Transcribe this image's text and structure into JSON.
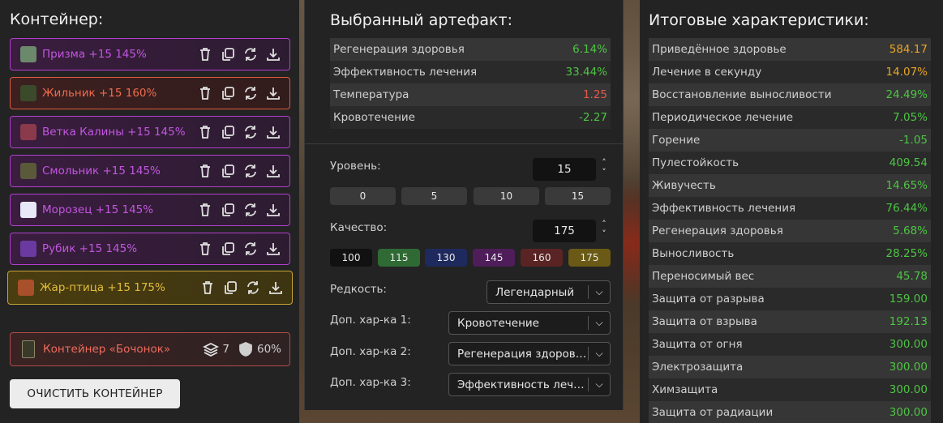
{
  "left": {
    "title": "Контейнер:",
    "items": [
      {
        "name": "Призма +15 145%",
        "variant": "purple",
        "thumb": "#6b8a6b"
      },
      {
        "name": "Жильник +15 160%",
        "variant": "red",
        "thumb": "#3a4a2a"
      },
      {
        "name": "Ветка Калины +15 145%",
        "variant": "purple",
        "thumb": "#8a3a4a"
      },
      {
        "name": "Смольник +15 145%",
        "variant": "purple",
        "thumb": "#5a5a3a"
      },
      {
        "name": "Морозец +15 145%",
        "variant": "purple",
        "thumb": "#e8e8f8"
      },
      {
        "name": "Рубик +15 145%",
        "variant": "purple",
        "thumb": "#6a3aa0"
      },
      {
        "name": "Жар-птица +15 175%",
        "variant": "gold",
        "thumb": "#a8502a"
      }
    ],
    "container": {
      "name": "Контейнер «Бочонок»",
      "slots": "7",
      "protection": "60%"
    },
    "clear_label": "ОЧИСТИТЬ КОНТЕЙНЕР"
  },
  "mid": {
    "title": "Выбранный артефакт:",
    "stats": [
      {
        "label": "Регенерация здоровья",
        "value": "6.14%",
        "tone": "g"
      },
      {
        "label": "Эффективность лечения",
        "value": "33.44%",
        "tone": "g"
      },
      {
        "label": "Температура",
        "value": "1.25",
        "tone": "r"
      },
      {
        "label": "Кровотечение",
        "value": "-2.27",
        "tone": "g"
      }
    ],
    "level_label": "Уровень:",
    "level_value": "15",
    "level_presets": [
      "0",
      "5",
      "10",
      "15"
    ],
    "quality_label": "Качество:",
    "quality_value": "175",
    "quality_presets": [
      {
        "label": "100",
        "color": "#111111"
      },
      {
        "label": "115",
        "color": "#2f6a34"
      },
      {
        "label": "130",
        "color": "#1e2a5e"
      },
      {
        "label": "145",
        "color": "#4e1d5a"
      },
      {
        "label": "160",
        "color": "#5a2424"
      },
      {
        "label": "175",
        "color": "#6a5a16"
      }
    ],
    "rarity_label": "Редкость:",
    "rarity_value": "Легендарный",
    "extra1_label": "Доп. хар-ка 1:",
    "extra1_value": "Кровотечение",
    "extra2_label": "Доп. хар-ка 2:",
    "extra2_value": "Регенерация здоровья",
    "extra3_label": "Доп. хар-ка 3:",
    "extra3_value": "Эффективность лечения"
  },
  "right": {
    "title": "Итоговые характеристики:",
    "stats": [
      {
        "label": "Приведённое здоровье",
        "value": "584.17",
        "tone": "o"
      },
      {
        "label": "Лечение в секунду",
        "value": "14.07%",
        "tone": "o"
      },
      {
        "label": "Восстановление выносливости",
        "value": "24.49%",
        "tone": "g"
      },
      {
        "label": "Периодическое лечение",
        "value": "7.05%",
        "tone": "g"
      },
      {
        "label": "Горение",
        "value": "-1.05",
        "tone": "g"
      },
      {
        "label": "Пулестойкость",
        "value": "409.54",
        "tone": "g"
      },
      {
        "label": "Живучесть",
        "value": "14.65%",
        "tone": "g"
      },
      {
        "label": "Эффективность лечения",
        "value": "76.44%",
        "tone": "g"
      },
      {
        "label": "Регенерация здоровья",
        "value": "5.68%",
        "tone": "g"
      },
      {
        "label": "Выносливость",
        "value": "28.25%",
        "tone": "g"
      },
      {
        "label": "Переносимый вес",
        "value": "45.78",
        "tone": "g"
      },
      {
        "label": "Защита от разрыва",
        "value": "159.00",
        "tone": "g"
      },
      {
        "label": "Защита от взрыва",
        "value": "192.13",
        "tone": "g"
      },
      {
        "label": "Защита от огня",
        "value": "300.00",
        "tone": "g"
      },
      {
        "label": "Электрозащита",
        "value": "300.00",
        "tone": "g"
      },
      {
        "label": "Химзащита",
        "value": "300.00",
        "tone": "g"
      },
      {
        "label": "Защита от радиации",
        "value": "300.00",
        "tone": "g"
      }
    ]
  }
}
